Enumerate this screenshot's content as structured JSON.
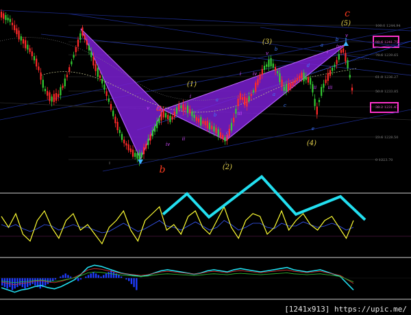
{
  "chart_data": [
    {
      "type": "candlestick",
      "panel": "price",
      "colors": {
        "up": "#33cc33",
        "down": "#ff2a2a",
        "pattern_fill": "#7a1fd1",
        "pattern_edge": "#c46bff",
        "highlight_box": "#ff33cc"
      },
      "price_ticks": [
        "100.0 1244.94",
        "88.6 1241.75",
        "78.6 1239.65",
        "61.8 1236.27",
        "50.0 1233.85",
        "38.2 1231.47",
        "23.6 1228.50",
        "0 1223.70"
      ],
      "highlighted_price_labels": [
        "88.6 1241.75",
        "38.2 1231.47"
      ],
      "wave_labels": {
        "red": [
          "a",
          "b",
          "c"
        ],
        "yellow": [
          "(1)",
          "(2)",
          "(3)",
          "(4)",
          "(5)"
        ],
        "purple": [
          "i",
          "ii",
          "iii",
          "iv",
          "v",
          "i",
          "ii",
          "iii",
          "iv",
          "v",
          "i",
          "ii",
          "iii",
          "iv",
          "v"
        ],
        "cyan_abc": [
          "a",
          "b",
          "c",
          "a",
          "b",
          "c",
          "d",
          "e",
          "a",
          "b"
        ]
      },
      "harmonic_pattern": "X-A-B-C-D butterfly (purple filled triangles)"
    },
    {
      "type": "line",
      "panel": "oscillator",
      "series": [
        {
          "color": "#ffff33",
          "values": [
            58,
            50,
            60,
            45,
            40,
            55,
            62,
            50,
            42,
            55,
            60,
            48,
            52,
            45,
            38,
            50,
            55,
            62,
            48,
            40,
            55,
            60,
            65,
            48,
            52,
            45,
            58,
            62,
            50,
            45,
            55,
            65,
            50,
            42,
            55,
            60,
            58,
            45,
            50,
            62,
            48,
            55,
            60,
            52,
            48,
            55,
            58,
            50,
            42,
            55
          ]
        },
        {
          "color": "#3a5bff",
          "values": [
            52,
            50,
            52,
            49,
            47,
            49,
            52,
            51,
            48,
            50,
            52,
            50,
            50,
            48,
            46,
            47,
            50,
            53,
            50,
            47,
            49,
            52,
            55,
            51,
            50,
            48,
            51,
            54,
            51,
            48,
            50,
            55,
            52,
            48,
            50,
            53,
            53,
            50,
            49,
            53,
            51,
            51,
            54,
            52,
            50,
            51,
            53,
            51,
            48,
            50
          ]
        }
      ],
      "trend_overlay": {
        "color": "#22dff0",
        "shape": "zigzag",
        "points": [
          [
            0.4,
            0.55
          ],
          [
            0.5,
            0.25
          ],
          [
            0.63,
            0.6
          ],
          [
            0.72,
            0.45
          ],
          [
            0.83,
            0.55
          ],
          [
            0.88,
            0.2
          ]
        ]
      }
    },
    {
      "type": "bar",
      "panel": "histogram",
      "series": [
        {
          "name": "",
          "color": "#1f3cff",
          "values": [
            -5,
            -6,
            -7,
            -6,
            -8,
            -7,
            -6,
            -5,
            -6,
            -7,
            -6,
            -5,
            -4,
            -5,
            -6,
            -7,
            -6,
            -5,
            -4,
            -3,
            -2,
            -1,
            0,
            1,
            2,
            3,
            2,
            1,
            0,
            -1,
            -2,
            -1,
            0,
            1,
            2,
            3,
            4,
            3,
            2,
            1,
            2,
            3,
            4,
            5,
            4,
            3,
            2,
            1,
            0,
            -1,
            -2,
            -4,
            -6,
            -8
          ]
        },
        {
          "name": "",
          "color": "#22dff0",
          "values": [
            -10,
            -12,
            -14,
            -12,
            -11,
            -9,
            -8,
            -10,
            -11,
            -9,
            -6,
            -3,
            2,
            8,
            10,
            9,
            7,
            5,
            3,
            2,
            1,
            0,
            1,
            3,
            5,
            6,
            5,
            4,
            3,
            2,
            3,
            5,
            6,
            5,
            4,
            6,
            7,
            6,
            5,
            4,
            5,
            6,
            7,
            8,
            6,
            5,
            4,
            5,
            6,
            4,
            2,
            0,
            -6,
            -12
          ]
        }
      ]
    }
  ],
  "footer": {
    "text": "[1241x913] https://upic.me/"
  }
}
